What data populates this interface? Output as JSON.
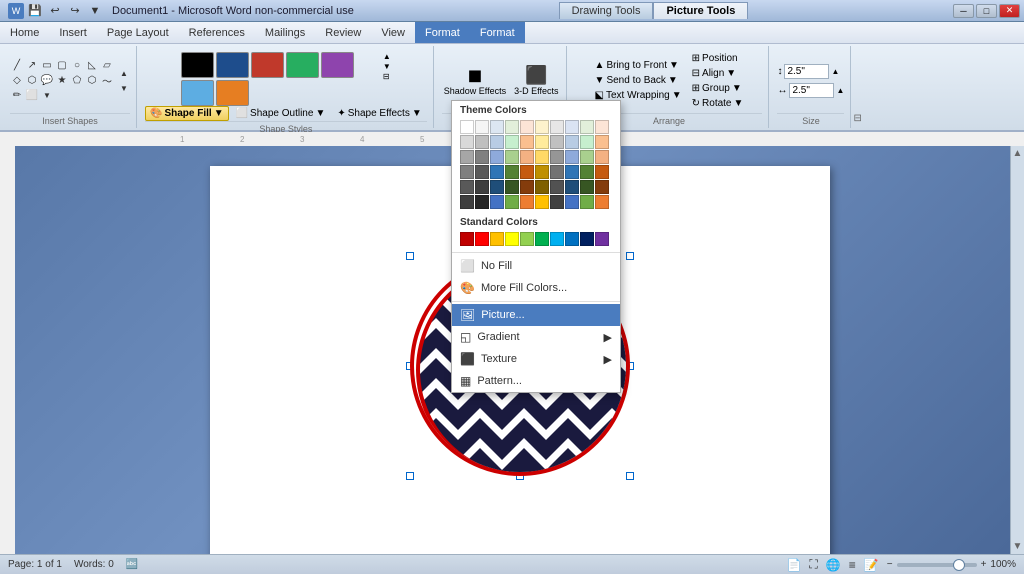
{
  "titlebar": {
    "title": "Document1 - Microsoft Word non-commercial use",
    "tabs": [
      "Drawing Tools",
      "Picture Tools"
    ],
    "quickaccess": [
      "save",
      "undo",
      "redo",
      "customize"
    ]
  },
  "menubar": {
    "items": [
      "Home",
      "Insert",
      "Page Layout",
      "References",
      "Mailings",
      "Review",
      "View",
      "Format",
      "Format"
    ],
    "active": "Format"
  },
  "ribbon": {
    "groups": [
      {
        "label": "Insert Shapes",
        "shapes": [
          "line",
          "arrow",
          "rect",
          "rounded",
          "oval",
          "callout",
          "connector",
          "curve",
          "freeform",
          "scribble",
          "flowchart1",
          "flowchart2",
          "action1",
          "action2",
          "star1",
          "star2",
          "callout2",
          "morebutton"
        ]
      },
      {
        "label": "Shape Styles",
        "swatches": [
          {
            "bg": "#000000",
            "border": "#888"
          },
          {
            "bg": "#1e4d8c",
            "border": "#1e4d8c"
          },
          {
            "bg": "#c0392b",
            "border": "#c0392b"
          },
          {
            "bg": "#27ae60",
            "border": "#27ae60"
          },
          {
            "bg": "#8e44ad",
            "border": "#8e44ad"
          },
          {
            "bg": "#5dade2",
            "border": "#5dade2"
          },
          {
            "bg": "#e67e22",
            "border": "#e67e22"
          }
        ]
      }
    ],
    "shapefill": {
      "label": "Shape Fill",
      "dropdown_visible": true
    },
    "shapeoutline": {
      "label": "Shape Outline"
    },
    "shapeeffects": {
      "label": "Shape Effects"
    },
    "effects3d": {
      "label": "3-D Effects",
      "btn": "3-D Effects"
    },
    "arrange": {
      "label": "Arrange",
      "bringtofront": "Bring to Front",
      "sendtoback": "Send to Back",
      "position": "Position",
      "align": "Align",
      "group": "Group",
      "rotate": "Rotate",
      "textwrapping": "Text Wrapping"
    },
    "size": {
      "label": "Size",
      "height": "2.5\"",
      "width": "2.5\""
    }
  },
  "dropdown": {
    "themecolors_label": "Theme Colors",
    "standardcolors_label": "Standard Colors",
    "theme_colors": [
      "#ffffff",
      "#f0f0f0",
      "#dce6f1",
      "#e2efda",
      "#fce4d6",
      "#fdf2cc",
      "#dce6f1",
      "#e2efda",
      "#fce4d6",
      "#fdf2cc",
      "#bfbfbf",
      "#808080",
      "#9dc3e6",
      "#a9d18e",
      "#f4b183",
      "#ffd966",
      "#9dc3e6",
      "#a9d18e",
      "#f4b183",
      "#ffd966",
      "#808080",
      "#404040",
      "#2e75b6",
      "#548235",
      "#c55a11",
      "#bf8f00",
      "#2e75b6",
      "#548235",
      "#c55a11",
      "#bf8f00",
      "#595959",
      "#262626",
      "#1f4e79",
      "#375623",
      "#833c00",
      "#7f6000",
      "#1f4e79",
      "#375623",
      "#833c00",
      "#7f6000",
      "#a8a8a8",
      "#737373",
      "#5b9bd5",
      "#70ad47",
      "#ed7d31",
      "#ffc000",
      "#5b9bd5",
      "#70ad47",
      "#ed7d31",
      "#ffc000",
      "#d9d9d9",
      "#e0e0e0",
      "#bdd7ee",
      "#c6efce",
      "#fce4d6",
      "#ffeb9c",
      "#bdd7ee",
      "#c6efce",
      "#fce4d6",
      "#ffeb9c"
    ],
    "standard_colors": [
      "#ff0000",
      "#ff0000",
      "#ffff00",
      "#ffff00",
      "#00ff00",
      "#00ff00",
      "#00ffff",
      "#0000ff",
      "#0000ff",
      "#7030a0"
    ],
    "no_fill": "No Fill",
    "more_fill_colors": "More Fill Colors...",
    "picture": "Picture...",
    "gradient": "Gradient",
    "texture": "Texture",
    "pattern": "Pattern...",
    "highlighted_item": "picture"
  },
  "statusbar": {
    "page": "Page: 1 of 1",
    "words": "Words: 0",
    "zoom": "100%",
    "view_icons": [
      "print",
      "fullscreen",
      "web",
      "outline",
      "draft"
    ]
  },
  "shape": {
    "pattern": "chevron",
    "fill_color": "#1a1a3e",
    "border_color": "#cc0000",
    "border_width": 4
  }
}
